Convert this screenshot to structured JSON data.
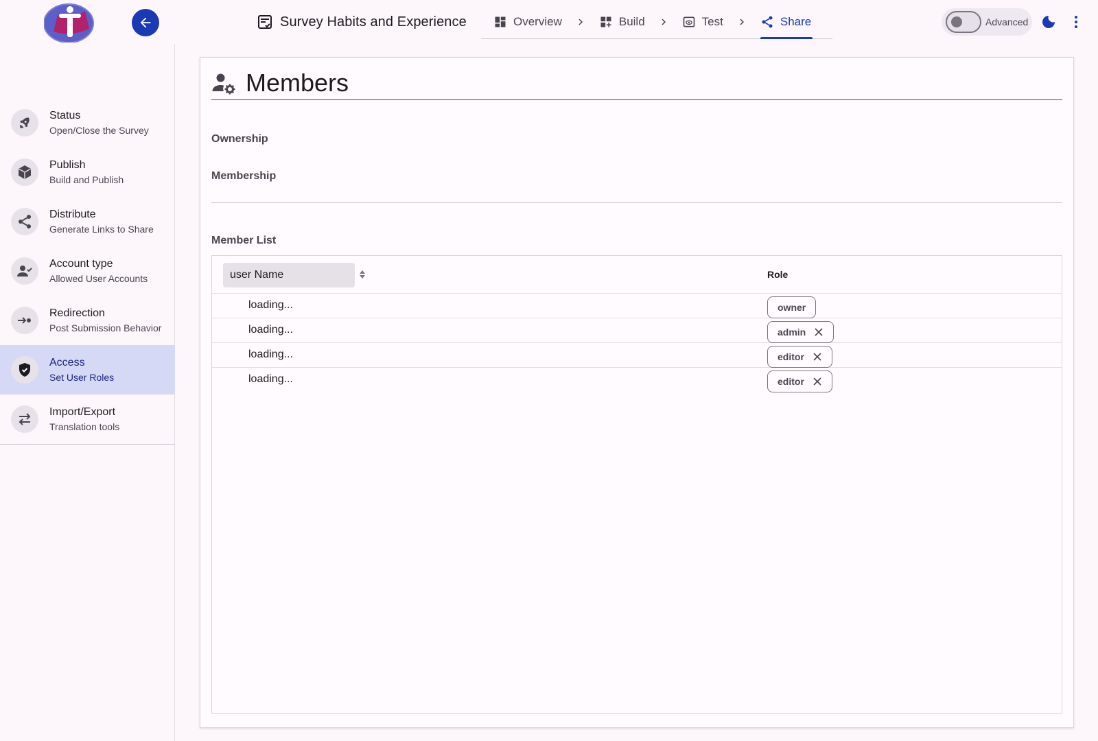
{
  "header": {
    "survey_title": "Survey Habits and Experience",
    "steps": [
      {
        "label": "Overview",
        "icon": "dashboard-icon"
      },
      {
        "label": "Build",
        "icon": "build-grid-icon"
      },
      {
        "label": "Test",
        "icon": "preview-icon"
      },
      {
        "label": "Share",
        "icon": "share-icon",
        "active": true
      }
    ],
    "advanced_label": "Advanced",
    "advanced_on": false
  },
  "sidebar": {
    "items": [
      {
        "title": "Status",
        "subtitle": "Open/Close the Survey",
        "icon": "rocket-icon"
      },
      {
        "title": "Publish",
        "subtitle": "Build and Publish",
        "icon": "cube-icon"
      },
      {
        "title": "Distribute",
        "subtitle": "Generate Links to Share",
        "icon": "share-icon"
      },
      {
        "title": "Account type",
        "subtitle": "Allowed User Accounts",
        "icon": "person-check-icon"
      },
      {
        "title": "Redirection",
        "subtitle": "Post Submission Behavior",
        "icon": "redirect-icon"
      },
      {
        "title": "Access",
        "subtitle": "Set User Roles",
        "icon": "shield-icon",
        "active": true
      },
      {
        "title": "Import/Export",
        "subtitle": "Translation tools",
        "icon": "swap-icon"
      }
    ]
  },
  "main": {
    "title": "Members",
    "ownership_label": "Ownership",
    "membership_label": "Membership",
    "member_list_label": "Member List",
    "table": {
      "sort_column_label": "user Name",
      "role_header": "Role",
      "rows": [
        {
          "name": "loading...",
          "role": "owner",
          "removable": false
        },
        {
          "name": "loading...",
          "role": "admin",
          "removable": true
        },
        {
          "name": "loading...",
          "role": "editor",
          "removable": true
        },
        {
          "name": "loading...",
          "role": "editor",
          "removable": true
        }
      ]
    }
  },
  "colors": {
    "accent": "#1a3ab5",
    "background": "#fdf7fc",
    "active_nav": "#d6d9f5"
  }
}
